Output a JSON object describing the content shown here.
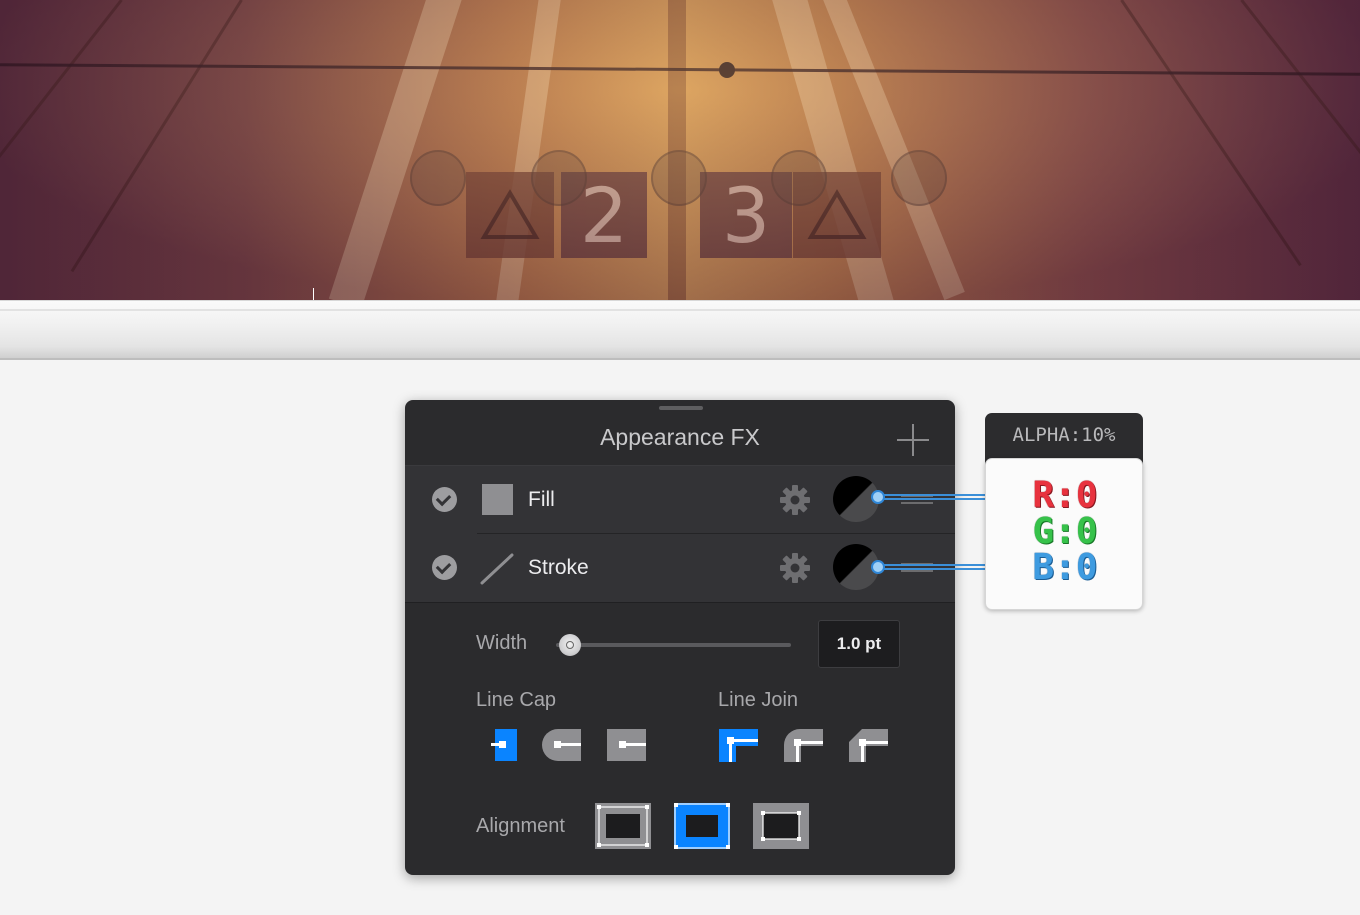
{
  "panel": {
    "title": "Appearance FX",
    "rows": [
      {
        "label": "Fill",
        "checked": true
      },
      {
        "label": "Stroke",
        "checked": true
      }
    ],
    "width": {
      "label": "Width",
      "value": "1.0 pt",
      "slider_fraction": 0.06
    },
    "line_cap": {
      "label": "Line Cap",
      "options": [
        "butt",
        "round",
        "square"
      ],
      "selected": "butt"
    },
    "line_join": {
      "label": "Line Join",
      "options": [
        "miter",
        "round",
        "bevel"
      ],
      "selected": "miter"
    },
    "alignment": {
      "label": "Alignment",
      "options": [
        "inside",
        "center",
        "outside"
      ],
      "selected": "center"
    }
  },
  "color_callout": {
    "alpha": "ALPHA:10%",
    "r": "R:0",
    "g": "G:0",
    "b": "B:0"
  },
  "photo": {
    "sign_numbers": [
      "2",
      "3"
    ]
  },
  "colors": {
    "accent": "#0a84ff",
    "panel_bg": "#2b2b2d",
    "row_bg": "#333336"
  }
}
